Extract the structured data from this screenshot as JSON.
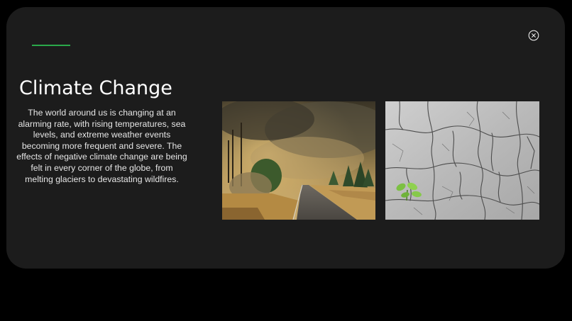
{
  "slide": {
    "title": "Climate Change",
    "body": "The world around us is changing at an alarming rate, with rising temperatures, sea levels, and extreme weather events becoming more frequent and severe. The effects of negative climate change are being felt in every corner of the globe, from melting glaciers to devastating wildfires."
  },
  "controls": {
    "close_icon": "close-circle-icon"
  },
  "images": [
    {
      "name": "wildfire-road-photo"
    },
    {
      "name": "cracked-earth-sprout-photo"
    }
  ],
  "colors": {
    "background": "#000000",
    "card": "#1c1c1c",
    "accent": "#2aa84a",
    "text": "#ffffff"
  }
}
